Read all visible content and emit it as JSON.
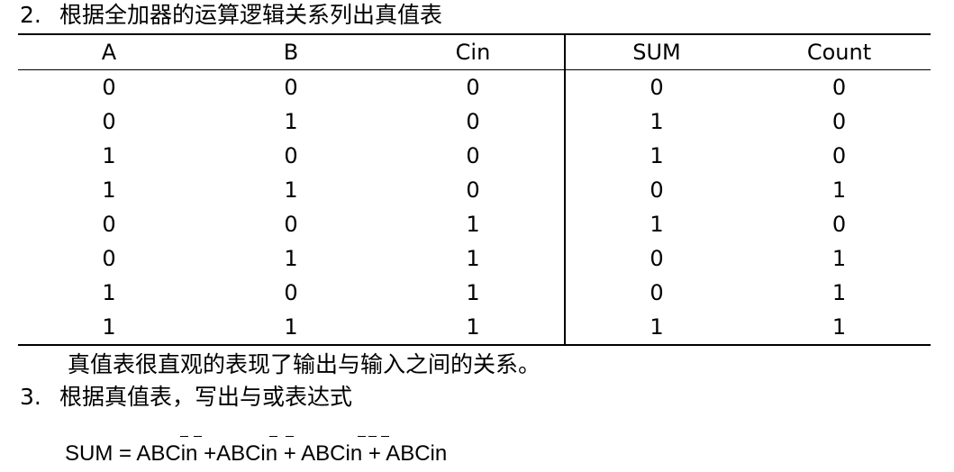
{
  "section2": {
    "number": "2.",
    "title": "根据全加器的运算逻辑关系列出真值表"
  },
  "truth_table": {
    "headers": [
      "A",
      "B",
      "Cin",
      "SUM",
      "Count"
    ],
    "rows": [
      [
        "0",
        "0",
        "0",
        "0",
        "0"
      ],
      [
        "0",
        "1",
        "0",
        "1",
        "0"
      ],
      [
        "1",
        "0",
        "0",
        "1",
        "0"
      ],
      [
        "1",
        "1",
        "0",
        "0",
        "1"
      ],
      [
        "0",
        "0",
        "1",
        "1",
        "0"
      ],
      [
        "0",
        "1",
        "1",
        "0",
        "1"
      ],
      [
        "1",
        "0",
        "1",
        "0",
        "1"
      ],
      [
        "1",
        "1",
        "1",
        "1",
        "1"
      ]
    ]
  },
  "note": "真值表很直观的表现了输出与输入之间的关系。",
  "section3": {
    "number": "3.",
    "title": "根据真值表，写出与或表达式"
  },
  "formula": {
    "lhs": "SUM =",
    "terms": [
      "ABCin",
      "ABCin",
      "ABCin",
      "ABCin"
    ],
    "operator": "+"
  }
}
